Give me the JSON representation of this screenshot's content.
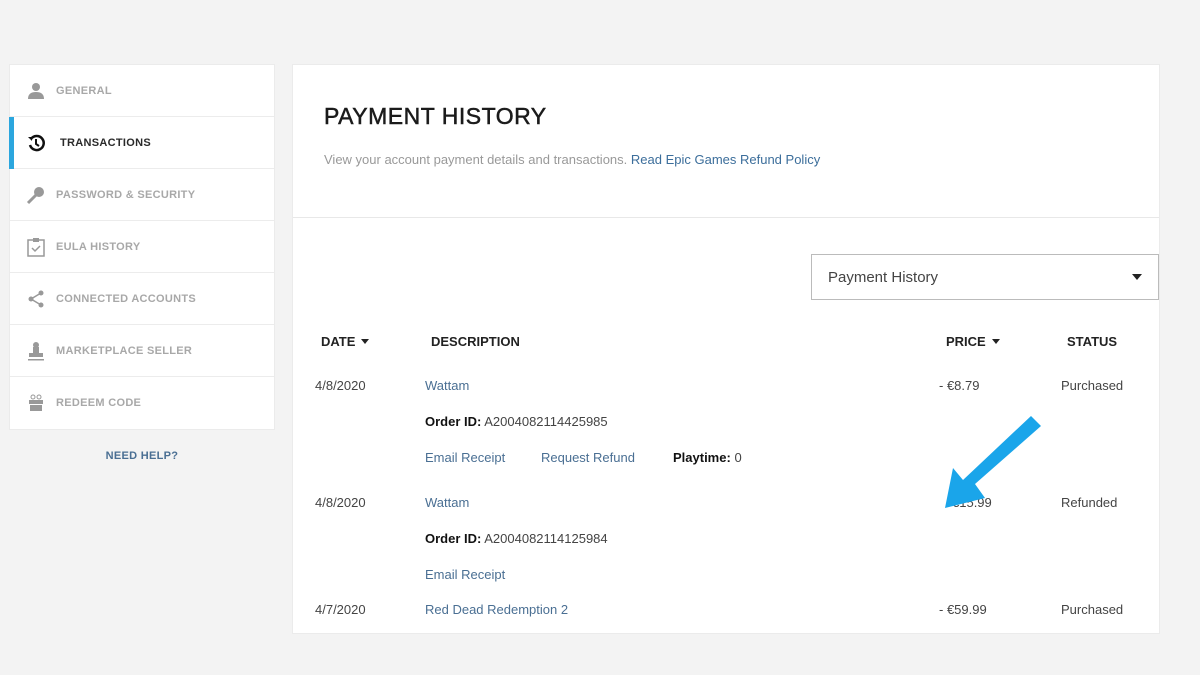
{
  "sidebar": {
    "items": [
      {
        "label": "GENERAL",
        "icon": "user-icon"
      },
      {
        "label": "TRANSACTIONS",
        "icon": "history-icon",
        "active": true
      },
      {
        "label": "PASSWORD & SECURITY",
        "icon": "key-icon"
      },
      {
        "label": "EULA HISTORY",
        "icon": "clipboard-check-icon"
      },
      {
        "label": "CONNECTED ACCOUNTS",
        "icon": "share-icon"
      },
      {
        "label": "MARKETPLACE SELLER",
        "icon": "stamp-icon"
      },
      {
        "label": "REDEEM CODE",
        "icon": "gift-icon"
      }
    ],
    "help": "NEED HELP?"
  },
  "header": {
    "title": "PAYMENT HISTORY",
    "subtitle": "View your account payment details and transactions.",
    "policy_link": "Read Epic Games Refund Policy"
  },
  "filter": {
    "selected": "Payment History"
  },
  "table": {
    "headers": {
      "date": "DATE",
      "description": "DESCRIPTION",
      "price": "PRICE",
      "status": "STATUS"
    },
    "rows": [
      {
        "date": "4/8/2020",
        "title": "Wattam",
        "order_label": "Order ID:",
        "order_id": "A2004082114425985",
        "email": "Email Receipt",
        "refund": "Request Refund",
        "playtime_label": "Playtime:",
        "playtime": "0",
        "price": "- €8.79",
        "status": "Purchased"
      },
      {
        "date": "4/8/2020",
        "title": "Wattam",
        "order_label": "Order ID:",
        "order_id": "A2004082114125984",
        "email": "Email Receipt",
        "price": "€15.99",
        "status": "Refunded"
      },
      {
        "date": "4/7/2020",
        "title": "Red Dead Redemption 2",
        "price": "- €59.99",
        "status": "Purchased"
      }
    ]
  },
  "colors": {
    "accent": "#2ba6de",
    "link": "#4a6f93",
    "arrow": "#1aa5ea"
  }
}
